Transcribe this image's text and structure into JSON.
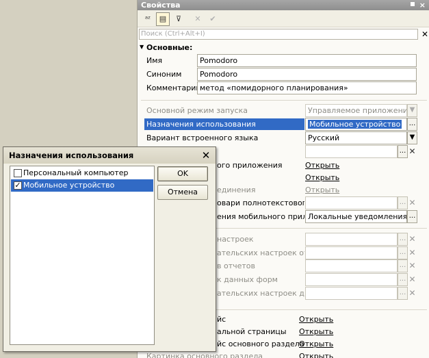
{
  "panel": {
    "title": "Свойства",
    "close_glyph": "×",
    "toolbar": [
      {
        "icon": "sort-alpha-icon",
        "glyph": "ᵃᶻ"
      },
      {
        "icon": "categorize-icon",
        "glyph": "▤"
      },
      {
        "icon": "filter-icon",
        "glyph": "⊽"
      },
      {
        "icon": "delete-icon",
        "glyph": "✕"
      },
      {
        "icon": "check-icon",
        "glyph": "✔"
      }
    ],
    "search_placeholder": "Поиск (Ctrl+Alt+I)",
    "search_clear": "✕",
    "group_title": "Основные:",
    "name_label": "Имя",
    "name_value": "Pomodoro",
    "synonym_label": "Синоним",
    "synonym_value": "Pomodoro",
    "comment_label": "Комментарий",
    "comment_value": "метод «помидорного планирования»",
    "launch_mode_label": "Основной режим запуска",
    "launch_mode_value": "Управляемое приложение",
    "purpose_label": "Назначения использования",
    "purpose_value": "Мобильное устройство",
    "lang_label": "Вариант встроенного языка",
    "lang_value": "Русский",
    "app_label": "ого приложения",
    "link_text": "Открыть",
    "connection_label": "единения",
    "fulltext_label": "овари полнотекстового п",
    "mobile_label": "ения мобильного приложе",
    "mobile_value": "Локальные уведомления, Во",
    "settings1_label": "настроек",
    "settings2_label": "ательских настроек отче",
    "reports_label": "в отчетов",
    "forms_label": "к данных форм",
    "settings3_label": "ательских настроек дина",
    "iface_label": "йс",
    "start_page_label": "альной страницы",
    "main_section_label": "йс основного раздела",
    "main_section2_label": "Картинка основного раздела",
    "ellipsis": "...",
    "clear": "✕",
    "dropdown": "▼"
  },
  "dialog": {
    "title": "Назначения использования",
    "close_glyph": "✕",
    "items": [
      {
        "label": "Персональный компьютер",
        "checked": false
      },
      {
        "label": "Мобильное устройство",
        "checked": true
      }
    ],
    "ok_label": "OK",
    "cancel_label": "Отмена"
  },
  "colors": {
    "selection": "#316ac5",
    "panel_bg": "#fbfaf6",
    "desktop_bg": "#d4d0c0"
  }
}
